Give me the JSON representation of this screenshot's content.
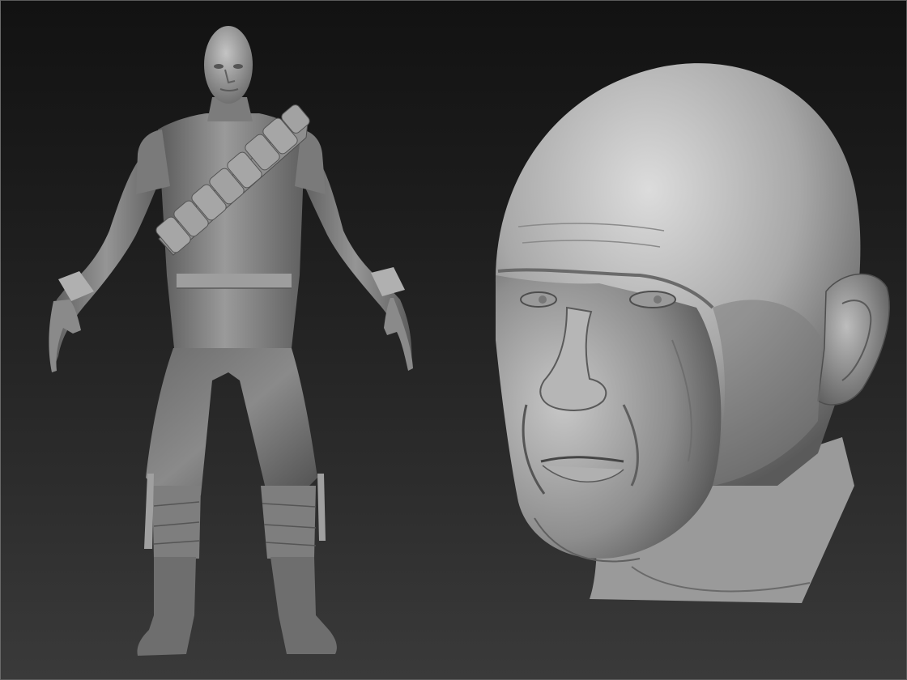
{
  "scene": {
    "background_top": "#121212",
    "background_bottom": "#3a3a3a",
    "material_color": "#8c8c8c",
    "objects": [
      {
        "name": "full-body-character-sculpt"
      },
      {
        "name": "head-bust-sculpt"
      }
    ]
  }
}
